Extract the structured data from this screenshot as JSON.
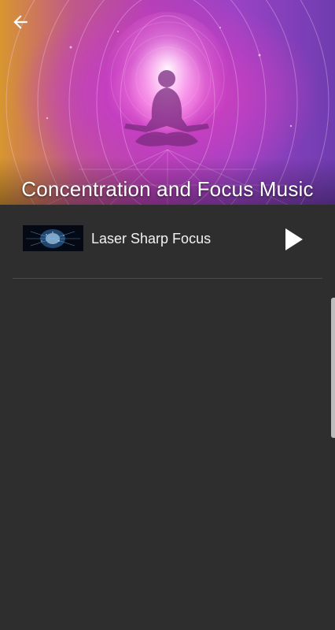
{
  "header": {
    "title": "Concentration and Focus Music",
    "back_icon": "arrow-left-icon",
    "artwork": "meditation-figure"
  },
  "tracks": [
    {
      "title": "Laser Sharp Focus",
      "thumbnail": "brain-network-thumbnail",
      "action_icon": "play-icon"
    }
  ],
  "colors": {
    "background": "#2e2e2e",
    "text": "#f2f2f2",
    "divider": "#4a4a4a",
    "scrollbar": "#bdbdbd"
  }
}
